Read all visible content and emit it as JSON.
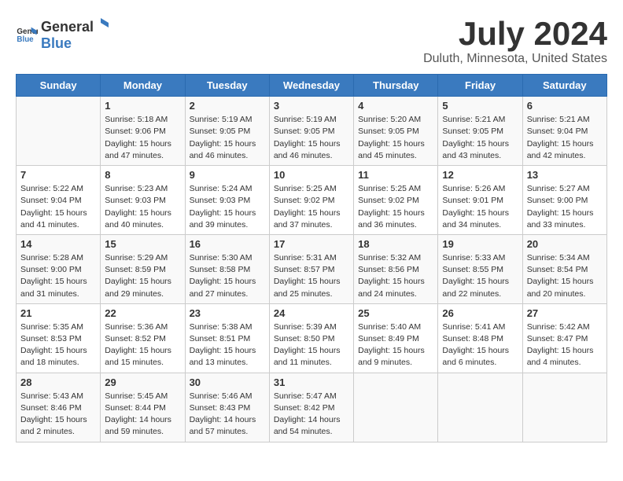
{
  "logo": {
    "general": "General",
    "blue": "Blue"
  },
  "title": "July 2024",
  "subtitle": "Duluth, Minnesota, United States",
  "headers": [
    "Sunday",
    "Monday",
    "Tuesday",
    "Wednesday",
    "Thursday",
    "Friday",
    "Saturday"
  ],
  "weeks": [
    [
      {
        "day": "",
        "info": ""
      },
      {
        "day": "1",
        "info": "Sunrise: 5:18 AM\nSunset: 9:06 PM\nDaylight: 15 hours\nand 47 minutes."
      },
      {
        "day": "2",
        "info": "Sunrise: 5:19 AM\nSunset: 9:05 PM\nDaylight: 15 hours\nand 46 minutes."
      },
      {
        "day": "3",
        "info": "Sunrise: 5:19 AM\nSunset: 9:05 PM\nDaylight: 15 hours\nand 46 minutes."
      },
      {
        "day": "4",
        "info": "Sunrise: 5:20 AM\nSunset: 9:05 PM\nDaylight: 15 hours\nand 45 minutes."
      },
      {
        "day": "5",
        "info": "Sunrise: 5:21 AM\nSunset: 9:05 PM\nDaylight: 15 hours\nand 43 minutes."
      },
      {
        "day": "6",
        "info": "Sunrise: 5:21 AM\nSunset: 9:04 PM\nDaylight: 15 hours\nand 42 minutes."
      }
    ],
    [
      {
        "day": "7",
        "info": "Sunrise: 5:22 AM\nSunset: 9:04 PM\nDaylight: 15 hours\nand 41 minutes."
      },
      {
        "day": "8",
        "info": "Sunrise: 5:23 AM\nSunset: 9:03 PM\nDaylight: 15 hours\nand 40 minutes."
      },
      {
        "day": "9",
        "info": "Sunrise: 5:24 AM\nSunset: 9:03 PM\nDaylight: 15 hours\nand 39 minutes."
      },
      {
        "day": "10",
        "info": "Sunrise: 5:25 AM\nSunset: 9:02 PM\nDaylight: 15 hours\nand 37 minutes."
      },
      {
        "day": "11",
        "info": "Sunrise: 5:25 AM\nSunset: 9:02 PM\nDaylight: 15 hours\nand 36 minutes."
      },
      {
        "day": "12",
        "info": "Sunrise: 5:26 AM\nSunset: 9:01 PM\nDaylight: 15 hours\nand 34 minutes."
      },
      {
        "day": "13",
        "info": "Sunrise: 5:27 AM\nSunset: 9:00 PM\nDaylight: 15 hours\nand 33 minutes."
      }
    ],
    [
      {
        "day": "14",
        "info": "Sunrise: 5:28 AM\nSunset: 9:00 PM\nDaylight: 15 hours\nand 31 minutes."
      },
      {
        "day": "15",
        "info": "Sunrise: 5:29 AM\nSunset: 8:59 PM\nDaylight: 15 hours\nand 29 minutes."
      },
      {
        "day": "16",
        "info": "Sunrise: 5:30 AM\nSunset: 8:58 PM\nDaylight: 15 hours\nand 27 minutes."
      },
      {
        "day": "17",
        "info": "Sunrise: 5:31 AM\nSunset: 8:57 PM\nDaylight: 15 hours\nand 25 minutes."
      },
      {
        "day": "18",
        "info": "Sunrise: 5:32 AM\nSunset: 8:56 PM\nDaylight: 15 hours\nand 24 minutes."
      },
      {
        "day": "19",
        "info": "Sunrise: 5:33 AM\nSunset: 8:55 PM\nDaylight: 15 hours\nand 22 minutes."
      },
      {
        "day": "20",
        "info": "Sunrise: 5:34 AM\nSunset: 8:54 PM\nDaylight: 15 hours\nand 20 minutes."
      }
    ],
    [
      {
        "day": "21",
        "info": "Sunrise: 5:35 AM\nSunset: 8:53 PM\nDaylight: 15 hours\nand 18 minutes."
      },
      {
        "day": "22",
        "info": "Sunrise: 5:36 AM\nSunset: 8:52 PM\nDaylight: 15 hours\nand 15 minutes."
      },
      {
        "day": "23",
        "info": "Sunrise: 5:38 AM\nSunset: 8:51 PM\nDaylight: 15 hours\nand 13 minutes."
      },
      {
        "day": "24",
        "info": "Sunrise: 5:39 AM\nSunset: 8:50 PM\nDaylight: 15 hours\nand 11 minutes."
      },
      {
        "day": "25",
        "info": "Sunrise: 5:40 AM\nSunset: 8:49 PM\nDaylight: 15 hours\nand 9 minutes."
      },
      {
        "day": "26",
        "info": "Sunrise: 5:41 AM\nSunset: 8:48 PM\nDaylight: 15 hours\nand 6 minutes."
      },
      {
        "day": "27",
        "info": "Sunrise: 5:42 AM\nSunset: 8:47 PM\nDaylight: 15 hours\nand 4 minutes."
      }
    ],
    [
      {
        "day": "28",
        "info": "Sunrise: 5:43 AM\nSunset: 8:46 PM\nDaylight: 15 hours\nand 2 minutes."
      },
      {
        "day": "29",
        "info": "Sunrise: 5:45 AM\nSunset: 8:44 PM\nDaylight: 14 hours\nand 59 minutes."
      },
      {
        "day": "30",
        "info": "Sunrise: 5:46 AM\nSunset: 8:43 PM\nDaylight: 14 hours\nand 57 minutes."
      },
      {
        "day": "31",
        "info": "Sunrise: 5:47 AM\nSunset: 8:42 PM\nDaylight: 14 hours\nand 54 minutes."
      },
      {
        "day": "",
        "info": ""
      },
      {
        "day": "",
        "info": ""
      },
      {
        "day": "",
        "info": ""
      }
    ]
  ]
}
